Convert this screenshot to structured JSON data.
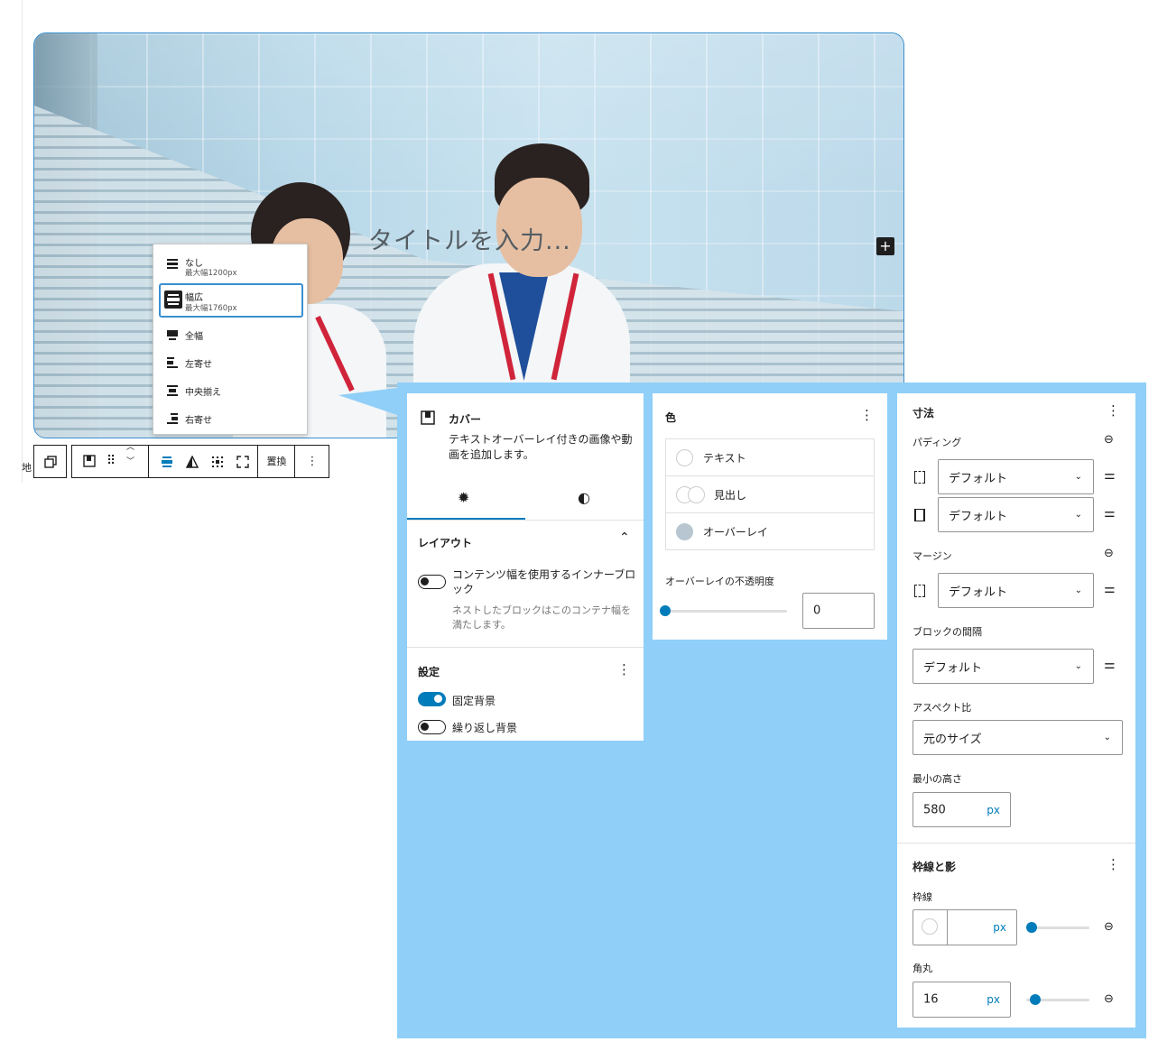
{
  "cover": {
    "title_placeholder": "タイトルを入力...",
    "add_label": "+"
  },
  "align_menu": {
    "options": [
      {
        "label": "なし",
        "sub": "最大幅1200px"
      },
      {
        "label": "幅広",
        "sub": "最大幅1760px",
        "selected": true
      },
      {
        "label": "全幅"
      },
      {
        "label": "左寄せ"
      },
      {
        "label": "中央揃え"
      },
      {
        "label": "右寄せ"
      }
    ]
  },
  "toolbar": {
    "replace_label": "置換",
    "more_label": "⋮",
    "left_text": "地"
  },
  "panel_block": {
    "name": "カバー",
    "description": "テキストオーバーレイ付きの画像や動画を追加します。",
    "layout_title": "レイアウト",
    "inner_toggle_label": "コンテンツ幅を使用するインナーブロック",
    "inner_toggle_help": "ネストしたブロックはこのコンテナ幅を満たします。",
    "settings_title": "設定",
    "fixed_bg_label": "固定背景",
    "fixed_bg_on": true,
    "repeat_bg_label": "繰り返し背景",
    "repeat_bg_on": false
  },
  "panel_color": {
    "title": "色",
    "items": [
      {
        "label": "テキスト"
      },
      {
        "label": "見出し"
      },
      {
        "label": "オーバーレイ",
        "color": "#b7c6d0"
      }
    ],
    "opacity_label": "オーバーレイの不透明度",
    "opacity_value": "0",
    "opacity_fraction": 0
  },
  "panel_dims": {
    "title": "寸法",
    "padding_label": "パディング",
    "padding_v": "デフォルト",
    "padding_h": "デフォルト",
    "margin_label": "マージン",
    "margin_v": "デフォルト",
    "gap_label": "ブロックの間隔",
    "gap_value": "デフォルト",
    "aspect_label": "アスペクト比",
    "aspect_value": "元のサイズ",
    "minheight_label": "最小の高さ",
    "minheight_value": "580",
    "unit": "px",
    "border_title": "枠線と影",
    "border_label": "枠線",
    "border_value": "",
    "radius_label": "角丸",
    "radius_value": "16"
  },
  "colors": {
    "accent": "#007cba",
    "backdrop": "#8fcff8"
  }
}
